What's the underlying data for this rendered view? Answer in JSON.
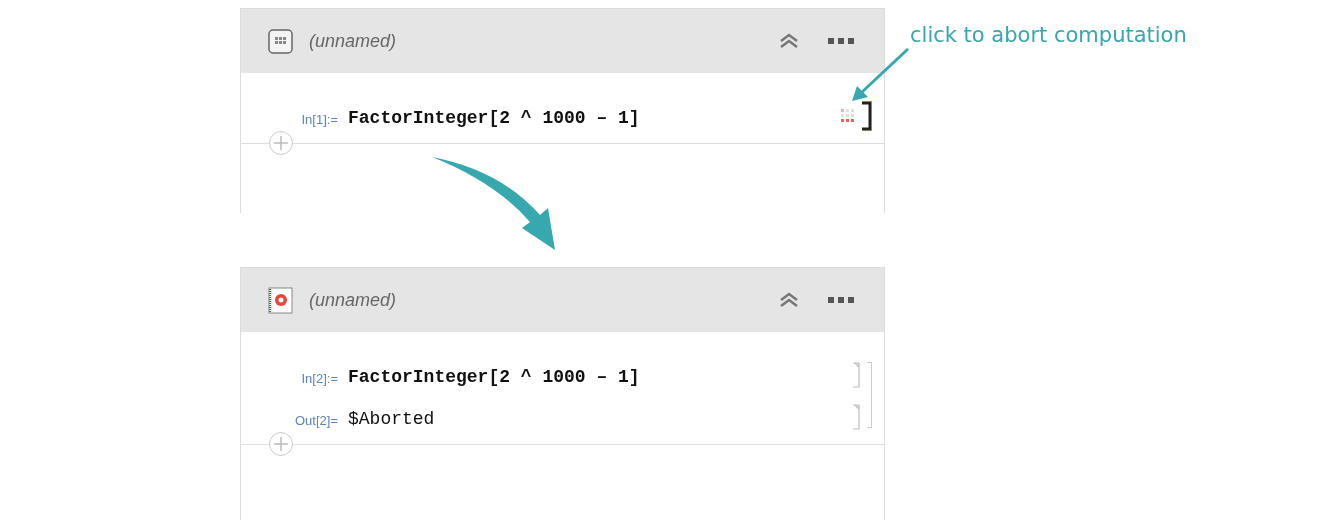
{
  "panels": [
    {
      "title": "(unnamed)",
      "running": true,
      "cells": [
        {
          "kind": "input",
          "label": "In[1]:=",
          "code": "FactorInteger[2 ^ 1000 – 1]"
        }
      ]
    },
    {
      "title": "(unnamed)",
      "running": false,
      "cells": [
        {
          "kind": "input",
          "label": "In[2]:=",
          "code": "FactorInteger[2 ^ 1000 – 1]"
        },
        {
          "kind": "output",
          "label": "Out[2]=",
          "code": "$Aborted"
        }
      ]
    }
  ],
  "annotation": {
    "text": "click to abort computation"
  }
}
